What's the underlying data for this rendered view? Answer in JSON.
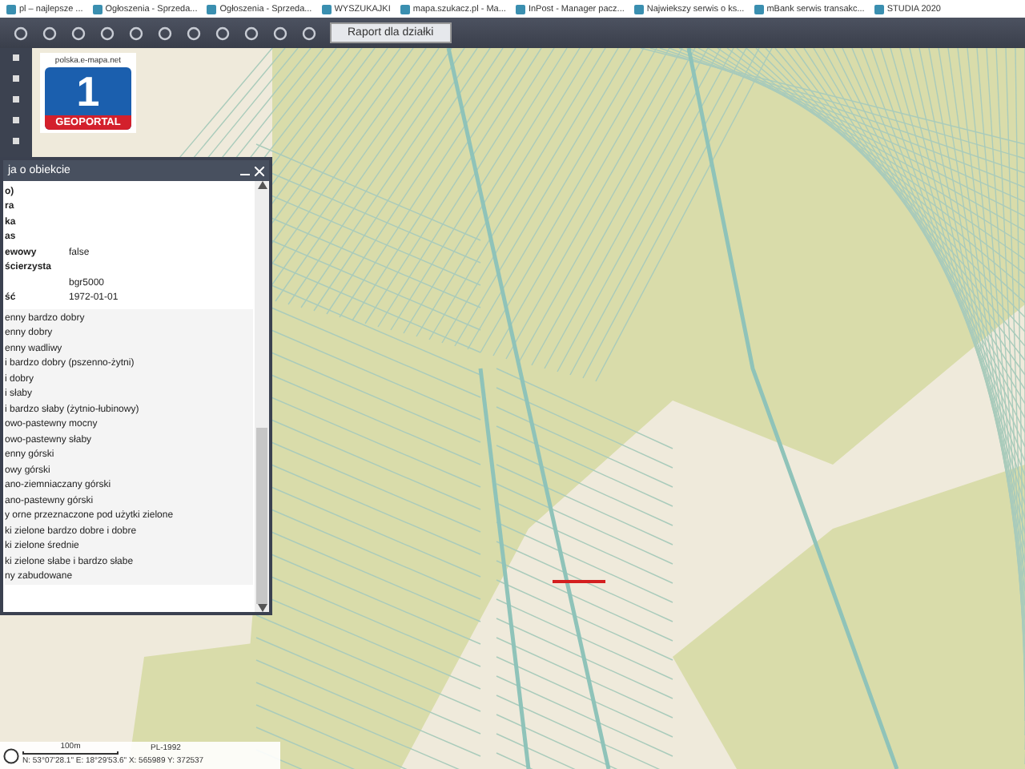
{
  "bookmarks": [
    "pl – najlepsze ...",
    "Ogłoszenia - Sprzeda...",
    "Ogłoszenia - Sprzeda...",
    "WYSZUKAJKI",
    "mapa.szukacz.pl - Ma...",
    "InPost - Manager pacz...",
    "Najwiekszy serwis o ks...",
    "mBank serwis transakc...",
    "STUDIA 2020"
  ],
  "toolbar": {
    "report_button": "Raport dla działki"
  },
  "logo": {
    "caption": "polska.e-mapa.net",
    "number": "1",
    "name": "GEOPORTAL"
  },
  "info_panel": {
    "title": "ja o obiekcie",
    "fields": [
      {
        "label": "o)"
      },
      {
        "label": "ra"
      },
      {
        "label": "ka"
      },
      {
        "label": "as"
      },
      {
        "label": "ewowy",
        "value": "false"
      },
      {
        "label": "ścierzysta"
      },
      {
        "value": "bgr5000"
      },
      {
        "label": "ść",
        "value": "1972-01-01"
      }
    ],
    "classes": [
      "enny bardzo dobry",
      "enny dobry",
      "enny wadliwy",
      "i bardzo dobry (pszenno-żytni)",
      "i dobry",
      "i słaby",
      "i bardzo słaby (żytnio-łubinowy)",
      "owo-pastewny mocny",
      "owo-pastewny słaby",
      "enny górski",
      "owy górski",
      "ano-ziemniaczany górski",
      "ano-pastewny górski",
      "y orne przeznaczone pod użytki zielone",
      "ki zielone bardzo dobre i dobre",
      "ki zielone średnie",
      "ki zielone słabe i bardzo słabe",
      "ny zabudowane"
    ]
  },
  "status": {
    "scale": "100m",
    "projection": "PL-1992",
    "coordinates": "N: 53°07'28.1\"  E: 18°29'53.6\"  X: 565989  Y: 372537"
  }
}
